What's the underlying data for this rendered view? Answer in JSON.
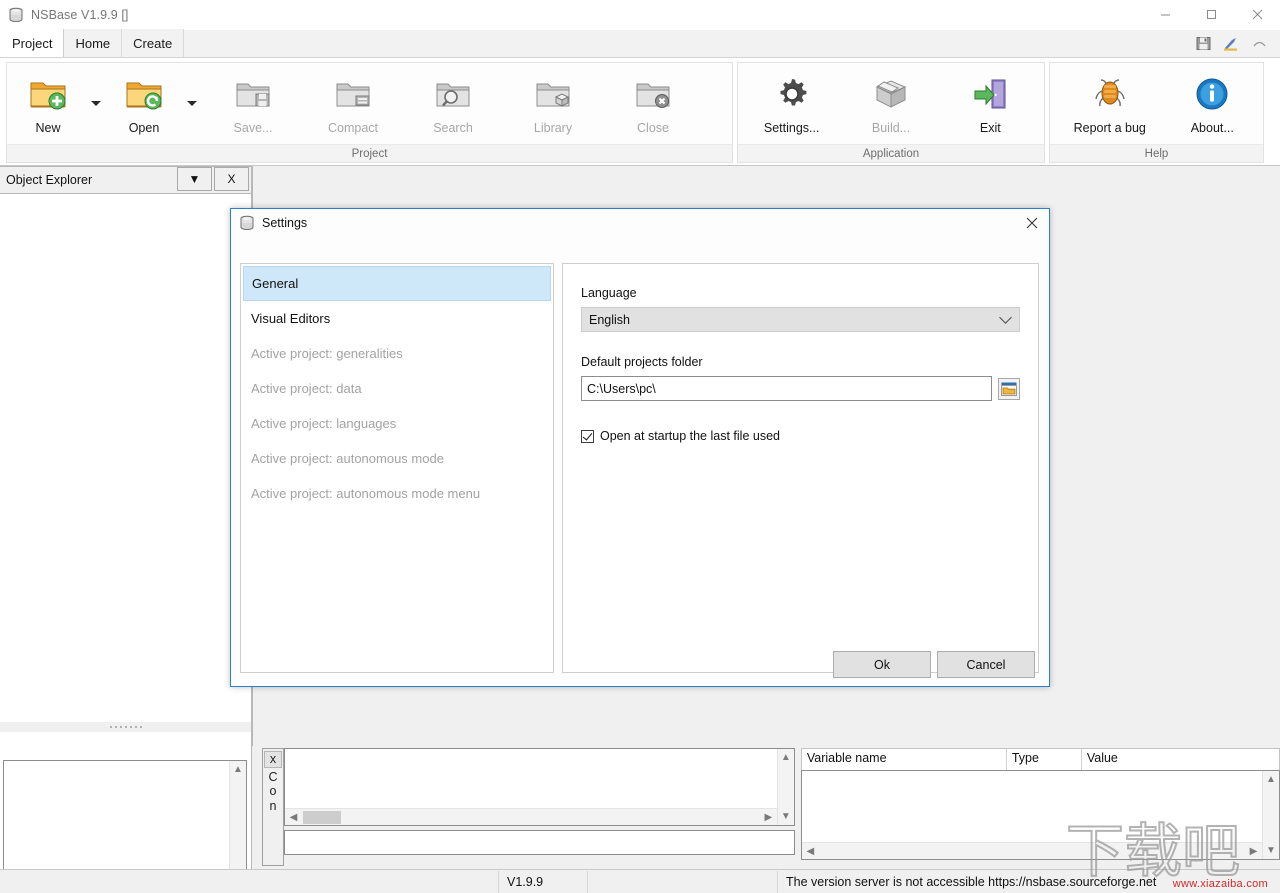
{
  "window": {
    "title": "NSBase V1.9.9 []",
    "icon": "database-icon",
    "controls": {
      "minimize": "—",
      "maximize": "□",
      "close": "✕"
    }
  },
  "tabs": [
    {
      "label": "Project",
      "active": true
    },
    {
      "label": "Home",
      "active": false
    },
    {
      "label": "Create",
      "active": false
    }
  ],
  "quick_access": [
    {
      "name": "save-icon"
    },
    {
      "name": "design-pencil-icon"
    },
    {
      "name": "chevron-up-icon"
    }
  ],
  "ribbon": {
    "groups": [
      {
        "title": "Project",
        "buttons": [
          {
            "label": "New",
            "icon": "folder-add-icon",
            "disabled": false,
            "dropdown": true
          },
          {
            "label": "Open",
            "icon": "folder-open-icon",
            "disabled": false,
            "dropdown": true
          },
          {
            "label": "Save...",
            "icon": "folder-save-icon",
            "disabled": true,
            "dropdown": false
          },
          {
            "label": "Compact",
            "icon": "folder-compact-icon",
            "disabled": true,
            "dropdown": false
          },
          {
            "label": "Search",
            "icon": "folder-search-icon",
            "disabled": true,
            "dropdown": false
          },
          {
            "label": "Library",
            "icon": "folder-library-icon",
            "disabled": true,
            "dropdown": false
          },
          {
            "label": "Close",
            "icon": "folder-close-icon",
            "disabled": true,
            "dropdown": false
          }
        ]
      },
      {
        "title": "Application",
        "buttons": [
          {
            "label": "Settings...",
            "icon": "gear-icon",
            "disabled": false,
            "dropdown": false
          },
          {
            "label": "Build...",
            "icon": "box-icon",
            "disabled": true,
            "dropdown": false
          },
          {
            "label": "Exit",
            "icon": "exit-door-icon",
            "disabled": false,
            "dropdown": false
          }
        ]
      },
      {
        "title": "Help",
        "buttons": [
          {
            "label": "Report a bug",
            "icon": "bug-icon",
            "disabled": false,
            "dropdown": false
          },
          {
            "label": "About...",
            "icon": "info-icon",
            "disabled": false,
            "dropdown": false
          }
        ]
      }
    ]
  },
  "object_explorer": {
    "title": "Object Explorer",
    "dropdown_label": "▼",
    "close_label": "X"
  },
  "console": {
    "vertical_label": "X C o n",
    "tab_close": "x",
    "tab_text": "Con",
    "output": "",
    "input": ""
  },
  "variables": {
    "columns": [
      "Variable name",
      "Type",
      "Value"
    ],
    "rows": []
  },
  "statusbar": {
    "version": "V1.9.9",
    "message": "The version server is not accessible https://nsbase.sourceforge.net"
  },
  "watermark": {
    "text": "下载吧",
    "url": "www.xiazaiba.com"
  },
  "settings_dialog": {
    "title": "Settings",
    "icon": "database-icon",
    "close_label": "✕",
    "nav_items": [
      {
        "label": "General",
        "selected": true,
        "disabled": false
      },
      {
        "label": "Visual Editors",
        "selected": false,
        "disabled": false
      },
      {
        "label": "Active project: generalities",
        "selected": false,
        "disabled": true
      },
      {
        "label": "Active project: data",
        "selected": false,
        "disabled": true
      },
      {
        "label": "Active project: languages",
        "selected": false,
        "disabled": true
      },
      {
        "label": "Active project: autonomous mode",
        "selected": false,
        "disabled": true
      },
      {
        "label": "Active project: autonomous mode menu",
        "selected": false,
        "disabled": true
      }
    ],
    "general": {
      "language_label": "Language",
      "language_value": "English",
      "language_options": [
        "English"
      ],
      "folder_label": "Default projects folder",
      "folder_value": "C:\\Users\\pc\\",
      "browse_icon": "folder-browse-icon",
      "checkbox_label": "Open at startup the last file used",
      "checkbox_checked": true
    },
    "buttons": {
      "ok": "Ok",
      "cancel": "Cancel"
    }
  },
  "colors": {
    "accent_blue": "#2f7fc4",
    "selection_blue": "#cfe8f9",
    "disabled_text": "#a3a3a3",
    "control_grey": "#e1e1e1",
    "watermark_red": "#cf2b2b"
  }
}
